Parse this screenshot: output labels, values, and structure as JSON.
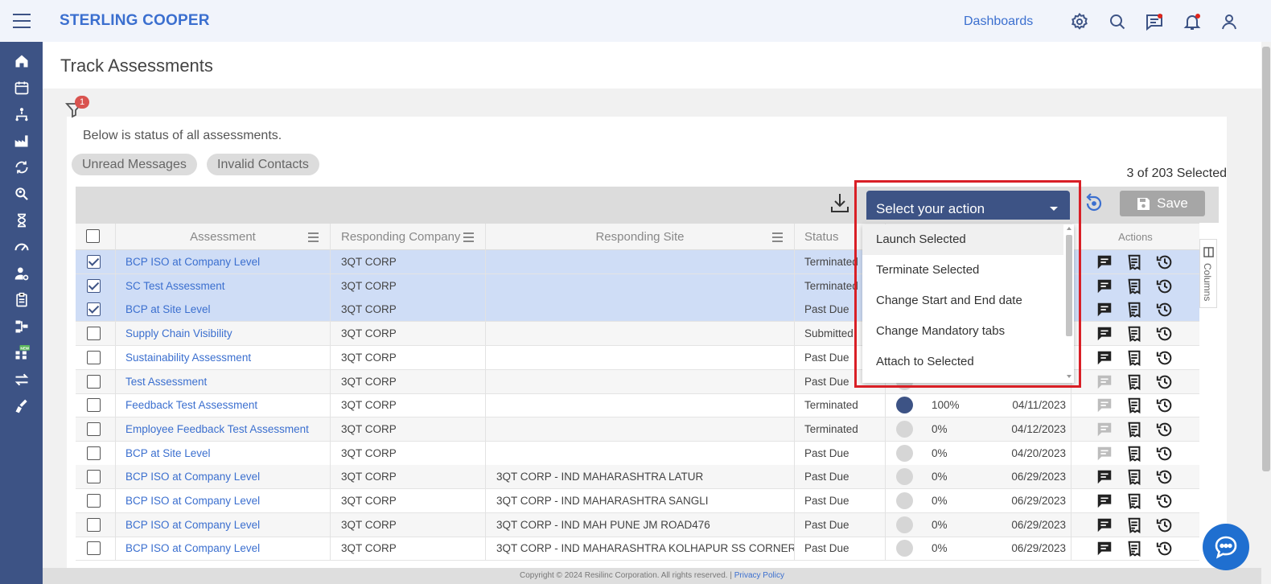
{
  "app": {
    "brand": "STERLING COOPER",
    "dashboards_link": "Dashboards"
  },
  "colors": {
    "rail": "#3d5385",
    "accent": "#3b6fcf",
    "selected_row": "#cfddf6",
    "highlight": "#d91f26"
  },
  "rail_icons": [
    "home-icon",
    "calendar-icon",
    "hierarchy-icon",
    "factory-icon",
    "cycle-icon",
    "search-user-icon",
    "hourglass-icon",
    "gauge-icon",
    "user-settings-icon",
    "clipboard-icon",
    "sitemap-icon",
    "new-grid-icon",
    "transfer-icon",
    "hand-edit-icon"
  ],
  "rail_new_badge": "NEW",
  "page": {
    "title": "Track Assessments",
    "filter_count": "1",
    "intro": "Below is status of all assessments.",
    "chips": [
      "Unread Messages",
      "Invalid Contacts"
    ],
    "selected_count": "3 of 203 Selected"
  },
  "toolbar": {
    "action_placeholder": "Select your action",
    "save_label": "Save"
  },
  "columns_tab": "Columns",
  "table": {
    "headers": {
      "assessment": "Assessment",
      "company": "Responding Company",
      "site": "Responding Site",
      "status": "Status",
      "actions": "Actions"
    },
    "rows": [
      {
        "checked": true,
        "assessment": "BCP ISO at Company Level",
        "company": "3QT CORP",
        "site": "",
        "status": "Terminated",
        "progress": "",
        "date": "",
        "full": false,
        "msg_active": true
      },
      {
        "checked": true,
        "assessment": "SC Test Assessment",
        "company": "3QT CORP",
        "site": "",
        "status": "Terminated",
        "progress": "",
        "date": "",
        "full": false,
        "msg_active": true
      },
      {
        "checked": true,
        "assessment": "BCP at Site Level",
        "company": "3QT CORP",
        "site": "",
        "status": "Past Due",
        "progress": "",
        "date": "",
        "full": false,
        "msg_active": true
      },
      {
        "checked": false,
        "assessment": "Supply Chain Visibility",
        "company": "3QT CORP",
        "site": "",
        "status": "Submitted",
        "progress": "",
        "date": "",
        "full": false,
        "msg_active": true
      },
      {
        "checked": false,
        "assessment": "Sustainability Assessment",
        "company": "3QT CORP",
        "site": "",
        "status": "Past Due",
        "progress": "",
        "date": "",
        "full": false,
        "msg_active": true
      },
      {
        "checked": false,
        "assessment": "Test Assessment",
        "company": "3QT CORP",
        "site": "",
        "status": "Past Due",
        "progress": "",
        "date": "",
        "full": false,
        "msg_active": false
      },
      {
        "checked": false,
        "assessment": "Feedback Test Assessment",
        "company": "3QT CORP",
        "site": "",
        "status": "Terminated",
        "progress": "100%",
        "date": "04/11/2023",
        "full": true,
        "msg_active": false
      },
      {
        "checked": false,
        "assessment": "Employee Feedback Test Assessment",
        "company": "3QT CORP",
        "site": "",
        "status": "Terminated",
        "progress": "0%",
        "date": "04/12/2023",
        "full": false,
        "msg_active": false
      },
      {
        "checked": false,
        "assessment": "BCP at Site Level",
        "company": "3QT CORP",
        "site": "",
        "status": "Past Due",
        "progress": "0%",
        "date": "04/20/2023",
        "full": false,
        "msg_active": false
      },
      {
        "checked": false,
        "assessment": "BCP ISO at Company Level",
        "company": "3QT CORP",
        "site": "3QT CORP - IND MAHARASHTRA LATUR",
        "status": "Past Due",
        "progress": "0%",
        "date": "06/29/2023",
        "full": false,
        "msg_active": true
      },
      {
        "checked": false,
        "assessment": "BCP ISO at Company Level",
        "company": "3QT CORP",
        "site": "3QT CORP - IND MAHARASHTRA SANGLI",
        "status": "Past Due",
        "progress": "0%",
        "date": "06/29/2023",
        "full": false,
        "msg_active": true
      },
      {
        "checked": false,
        "assessment": "BCP ISO at Company Level",
        "company": "3QT CORP",
        "site": "3QT CORP - IND MAH PUNE JM ROAD476",
        "status": "Past Due",
        "progress": "0%",
        "date": "06/29/2023",
        "full": false,
        "msg_active": true
      },
      {
        "checked": false,
        "assessment": "BCP ISO at Company Level",
        "company": "3QT CORP",
        "site": "3QT CORP - IND MAHARASHTRA KOLHAPUR SS CORNER",
        "status": "Past Due",
        "progress": "0%",
        "date": "06/29/2023",
        "full": false,
        "msg_active": true
      }
    ]
  },
  "dropdown": {
    "items": [
      "Launch Selected",
      "Terminate Selected",
      "Change Start and End date",
      "Change Mandatory tabs",
      "Attach to Selected"
    ],
    "hidden_partial_date": "04/11/2023"
  },
  "footer": {
    "copyright": "Copyright © 2024 Resilinc Corporation. All rights reserved. |",
    "privacy": "Privacy Policy"
  }
}
